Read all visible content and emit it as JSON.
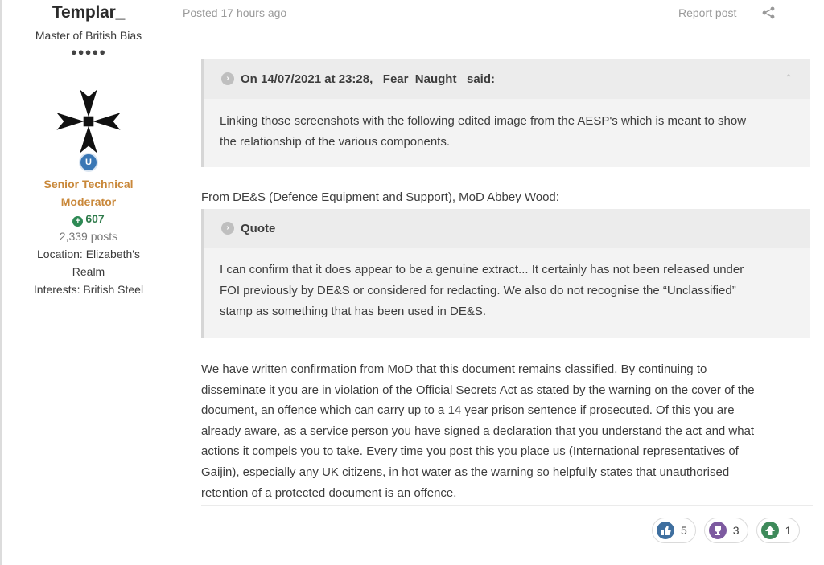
{
  "author": {
    "name": "Templar_",
    "title": "Master of British Bias",
    "pips": "●●●●●",
    "badge_letter": "U",
    "group_line1": "Senior Technical",
    "group_line2": "Moderator",
    "reputation": "607",
    "posts": "2,339 posts",
    "location_line1": "Location: Elizabeth's",
    "location_line2": "Realm",
    "interests": "Interests: British Steel"
  },
  "post": {
    "posted": "Posted 17 hours ago",
    "report": "Report post"
  },
  "quote1": {
    "header": "On 14/07/2021 at 23:28, _Fear_Naught_ said:",
    "line1": "Linking those screenshots with the following edited image from the AESP's which is meant to show",
    "line2": "the relationship of the various components."
  },
  "between": "From DE&S (Defence Equipment and Support), MoD Abbey Wood:",
  "quote2": {
    "header": "Quote",
    "line1": "I can confirm that it does appear to be a genuine extract...  It certainly has not been released under",
    "line2": "FOI previously by DE&S or considered for redacting.  We also do not recognise the “Unclassified”",
    "line3": "stamp as something that has been used in DE&S."
  },
  "body": {
    "line1": "We have written confirmation from MoD that this document remains classified. By continuing to",
    "line2": "disseminate it you are in violation of the Official Secrets Act as stated by the warning on the cover of the",
    "line3": "document, an offence which can carry up to a 14 year prison sentence if prosecuted. Of this you are",
    "line4": "already aware, as a service person you have signed a declaration that you understand the act and what",
    "line5": "actions it compels you to take. Every time you post this you place us (International representatives of",
    "line6": "Gaijin), especially any UK citizens, in hot water as the warning so helpfully states that unauthorised",
    "line7": "retention of a protected document is an offence."
  },
  "reactions": [
    {
      "count": "5",
      "icon": "like-icon",
      "color": "#3f6f9f"
    },
    {
      "count": "3",
      "icon": "trophy-icon",
      "color": "#7d5aa0"
    },
    {
      "count": "1",
      "icon": "upvote-icon",
      "color": "#3e8a5a"
    }
  ],
  "colors": {
    "group": "#c9883a",
    "reputation": "#2e7a4a",
    "badge": "#3a77b5"
  }
}
